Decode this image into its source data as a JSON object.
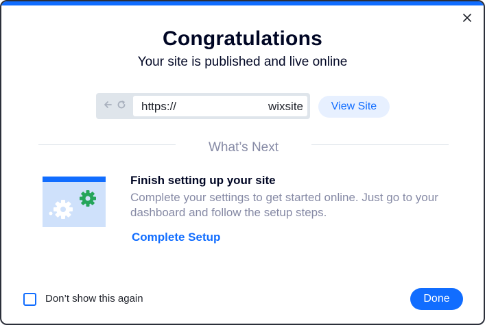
{
  "dialog": {
    "title": "Congratulations",
    "subtitle": "Your site is published and live online"
  },
  "url_bar": {
    "url_prefix": "https://",
    "url_domain": "wixsite",
    "view_site_label": "View Site"
  },
  "whats_next": {
    "heading": "What’s Next",
    "task_title": "Finish setting up your site",
    "task_description": "Complete your settings to get started online. Just go to your dashboard and follow the setup steps.",
    "cta_label": "Complete Setup"
  },
  "footer": {
    "checkbox_label": "Don’t show this again",
    "done_label": "Done"
  },
  "colors": {
    "accent": "#116dff",
    "accent_light": "#e7f0ff",
    "text_primary": "#000624",
    "text_secondary": "#868aa5",
    "gear_green": "#25a55a",
    "illustration_bg": "#cfe1fb"
  },
  "icons": [
    "close-icon",
    "back-arrow-icon",
    "refresh-icon",
    "gear-icon"
  ]
}
